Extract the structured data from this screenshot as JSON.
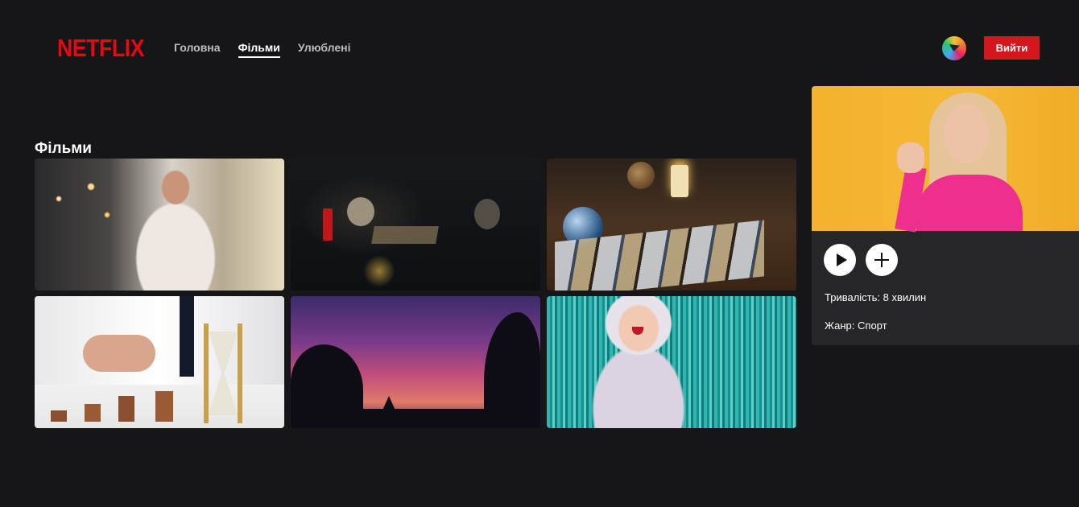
{
  "header": {
    "logo": "NETFLIX",
    "nav": [
      {
        "label": "Головна",
        "active": false
      },
      {
        "label": "Фільми",
        "active": true
      },
      {
        "label": "Улюблені",
        "active": false
      }
    ],
    "logout_label": "Вийти"
  },
  "main": {
    "section_title": "Фільми",
    "movies": [
      {
        "image": "woman-with-phone-and-coffee"
      },
      {
        "image": "skulls-and-candles"
      },
      {
        "image": "tarot-cards-table"
      },
      {
        "image": "coins-and-hourglass"
      },
      {
        "image": "purple-sunset-trees"
      },
      {
        "image": "woman-surprised-teal-tinsel"
      }
    ]
  },
  "detail": {
    "image": "angry-woman-pink-sweater",
    "duration_text": "Тривалість: 8 хвилин",
    "genre_text": "Жанр: Спорт"
  },
  "colors": {
    "background": "#161618",
    "brand": "#e50914",
    "logout_button": "#d4161d",
    "panel": "#262628"
  }
}
